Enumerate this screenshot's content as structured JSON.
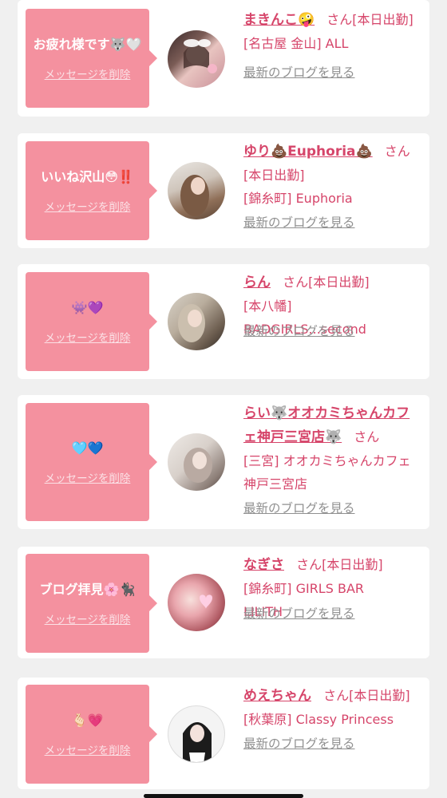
{
  "entries": [
    {
      "message": "お疲れ様です🐺🤍",
      "delete_label": "メッセージを削除",
      "name": "まきんこ🤪",
      "honorific": "さん",
      "status": "[本日出勤]",
      "shop": "[名古屋 金山] ALL",
      "blog_link": "最新のブログを見る"
    },
    {
      "message": "いいね沢山😳‼️",
      "delete_label": "メッセージを削除",
      "name": "ゆり💩Euphoria💩",
      "honorific": "さん",
      "status": "[本日出勤]",
      "shop": "[錦糸町] Euphoria",
      "blog_link": "最新のブログを見る"
    },
    {
      "message": "👾💜",
      "delete_label": "メッセージを削除",
      "name": "らん",
      "honorific": "さん",
      "status": "[本日出勤]",
      "shop": "[本八幡] BADGIRLS...second",
      "blog_link": "最新のブログを見る"
    },
    {
      "message": "🩵💙",
      "delete_label": "メッセージを削除",
      "name": "らい🐺オオカミちゃんカフェ神戸三宮店🐺",
      "honorific": "さん",
      "status": "",
      "shop": "[三宮] オオカミちゃんカフェ神戸三宮店",
      "blog_link": "最新のブログを見る"
    },
    {
      "message": "ブログ拝見🌸🐈‍⬛",
      "delete_label": "メッセージを削除",
      "name": "なぎさ",
      "honorific": "さん",
      "status": "[本日出勤]",
      "shop": "[錦糸町] GIRLS BAR LILITH",
      "blog_link": "最新のブログを見る"
    },
    {
      "message": "🫰🏻💗",
      "delete_label": "メッセージを削除",
      "name": "めえちゃん",
      "honorific": "さん",
      "status": "[本日出勤]",
      "shop": "[秋葉原] Classy Princess",
      "blog_link": "最新のブログを見る"
    }
  ],
  "colors": {
    "accent": "#d6456a",
    "bubble": "#f4919f",
    "background": "#f0f0f0",
    "link_gray": "#909090"
  }
}
